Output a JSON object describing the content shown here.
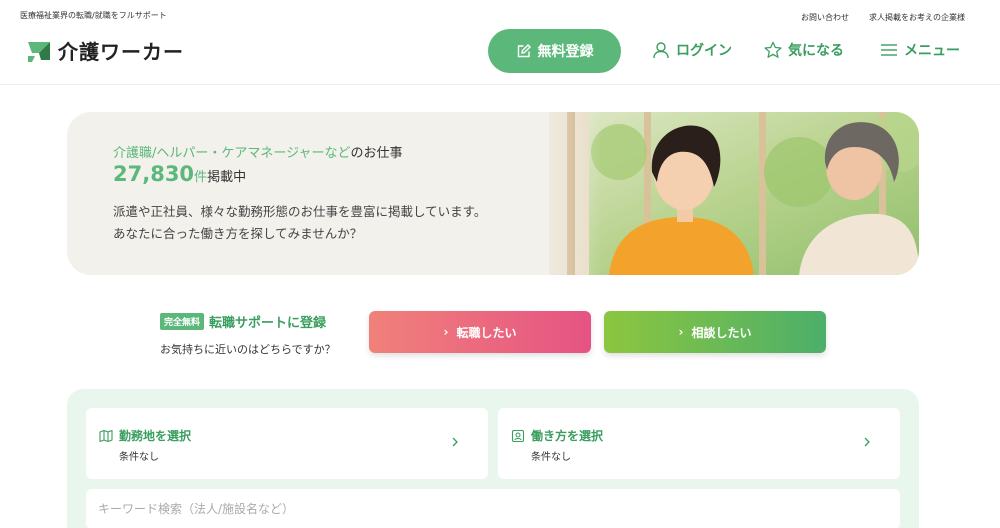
{
  "header": {
    "tagline": "医療福祉業界の転職/就職をフルサポート",
    "top_links": [
      "お問い合わせ",
      "求人掲載をお考えの企業様"
    ],
    "logo_text": "介護ワーカー",
    "register_label": "無料登録",
    "nav": {
      "login": "ログイン",
      "favorite": "気になる",
      "menu": "メニュー"
    }
  },
  "hero": {
    "line1_prefix": "介護職/ヘルパー・ケアマネージャーなど",
    "line1_suffix": "のお仕事",
    "count": "27,830",
    "count_unit": "件",
    "count_suffix": "掲載中",
    "desc_line1": "派遣や正社員、様々な勤務形態のお仕事を豊富に掲載しています。",
    "desc_line2": "あなたに合った働き方を探してみませんか？"
  },
  "support": {
    "badge": "完全無料",
    "title": "転職サポートに登録",
    "subtitle": "お気持ちに近いのはどちらですか？",
    "btn_change": "転職したい",
    "btn_consult": "相談したい"
  },
  "search": {
    "place_label": "勤務地を選択",
    "place_value": "条件なし",
    "style_label": "働き方を選択",
    "style_value": "条件なし",
    "keyword_placeholder": "キーワード検索（法人/施設名など）"
  },
  "colors": {
    "brand": "#5cb87a",
    "brand_text": "#3a9e5f",
    "cta_pink": "#e65383",
    "cta_green": "#4caf6a"
  },
  "icons": {
    "register": "pencil-square-icon",
    "login": "user-icon",
    "favorite": "star-icon",
    "menu": "hamburger-icon",
    "place": "map-icon",
    "style": "id-card-icon"
  }
}
